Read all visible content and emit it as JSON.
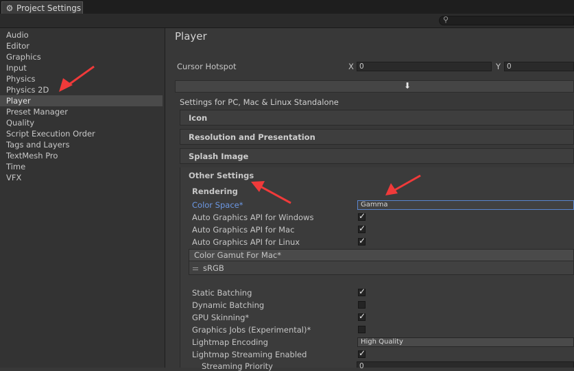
{
  "window": {
    "tab_title": "Project Settings"
  },
  "sidebar": {
    "items": [
      {
        "label": "Audio"
      },
      {
        "label": "Editor"
      },
      {
        "label": "Graphics"
      },
      {
        "label": "Input"
      },
      {
        "label": "Physics"
      },
      {
        "label": "Physics 2D"
      },
      {
        "label": "Player"
      },
      {
        "label": "Preset Manager"
      },
      {
        "label": "Quality"
      },
      {
        "label": "Script Execution Order"
      },
      {
        "label": "Tags and Layers"
      },
      {
        "label": "TextMesh Pro"
      },
      {
        "label": "Time"
      },
      {
        "label": "VFX"
      }
    ],
    "selected": "Player"
  },
  "main": {
    "title": "Player",
    "cursor_hotspot": {
      "label": "Cursor Hotspot",
      "x_label": "X",
      "x_value": "0",
      "y_label": "Y",
      "y_value": "0"
    },
    "platform_label": "Settings for PC, Mac & Linux Standalone",
    "sections": {
      "icon": "Icon",
      "resolution": "Resolution and Presentation",
      "splash": "Splash Image",
      "other": "Other Settings"
    },
    "rendering": {
      "header": "Rendering",
      "color_space_label": "Color Space*",
      "color_space_value": "Gamma",
      "auto_api_windows": "Auto Graphics API  for Windows",
      "auto_api_mac": "Auto Graphics API  for Mac",
      "auto_api_linux": "Auto Graphics API  for Linux",
      "gamut_header": "Color Gamut For Mac*",
      "gamut_item": "sRGB",
      "static_batching": "Static Batching",
      "dynamic_batching": "Dynamic Batching",
      "gpu_skinning": "GPU Skinning*",
      "graphics_jobs": "Graphics Jobs (Experimental)*",
      "lightmap_encoding": "Lightmap Encoding",
      "lightmap_encoding_value": "High Quality",
      "lightmap_streaming": "Lightmap Streaming Enabled",
      "streaming_priority": "Streaming Priority",
      "streaming_priority_value": "0"
    }
  },
  "colors": {
    "annotation_arrow": "#f03a3a",
    "link_blue": "#6c98e4",
    "focus_border": "#5a86cf"
  }
}
